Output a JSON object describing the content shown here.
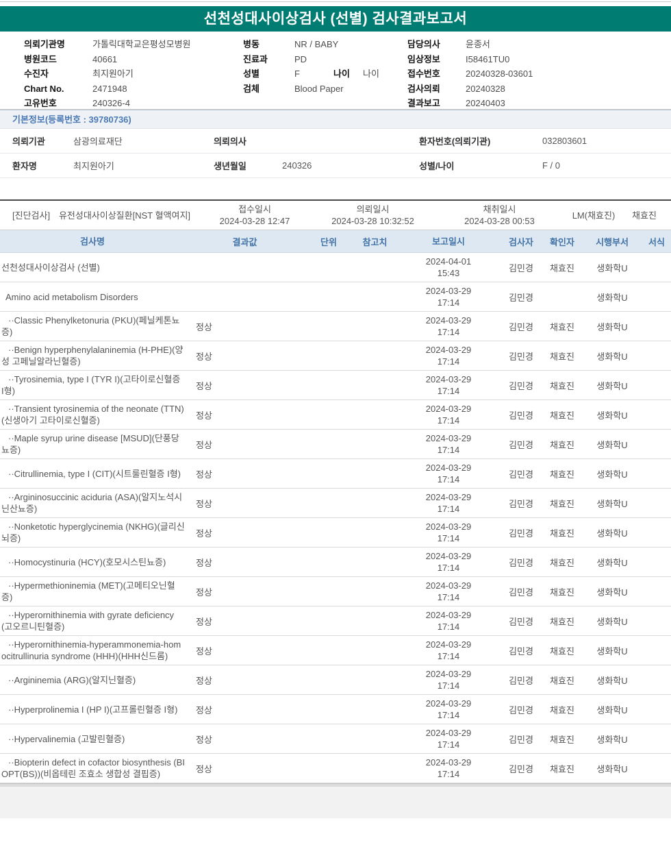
{
  "header": {
    "title": "선천성대사이상검사 (선별) 검사결과보고서",
    "accent_color": "#007c72"
  },
  "patient": {
    "col1": [
      {
        "label": "의뢰기관명",
        "value": "가톨릭대학교은평성모병원"
      },
      {
        "label": "병원코드",
        "value": "40661"
      },
      {
        "label": "수진자",
        "value": "최지원아기"
      },
      {
        "label": "Chart No.",
        "value": "2471948"
      },
      {
        "label": "고유번호",
        "value": "240326-4"
      }
    ],
    "col2": [
      {
        "label": "병동",
        "value": "NR / BABY"
      },
      {
        "label": "진료과",
        "value": "PD"
      },
      {
        "label": "성별",
        "value": "F",
        "label2": "나이",
        "value2": "나이"
      },
      {
        "label": "검체",
        "value": "Blood Paper"
      }
    ],
    "col3": [
      {
        "label": "담당의사",
        "value": "윤종서"
      },
      {
        "label": "임상정보",
        "value": "I58461TU0"
      },
      {
        "label": "접수번호",
        "value": "20240328-03601"
      },
      {
        "label": "검사의뢰",
        "value": "20240328"
      },
      {
        "label": "결과보고",
        "value": "20240403"
      }
    ]
  },
  "basic_info": {
    "title": "기본정보(등록번호 : 39780736)",
    "rows": [
      [
        {
          "label": "의뢰기관",
          "value": "삼광의료재단"
        },
        {
          "label": "의뢰의사",
          "value": ""
        },
        {
          "label": "환자번호(의뢰기관)",
          "value": "032803601"
        }
      ],
      [
        {
          "label": "환자명",
          "value": "최지원아기"
        },
        {
          "label": "생년월일",
          "value": "240326"
        },
        {
          "label": "성별/나이",
          "value": "F / 0"
        }
      ]
    ]
  },
  "diagnostic": {
    "section_label": "[진단검사]",
    "test_name": "유전성대사이상질환[NST 혈액여지]",
    "received_label": "접수일시",
    "received": "2024-03-28 12:47",
    "requested_label": "의뢰일시",
    "requested": "2024-03-28 10:32:52",
    "collected_label": "채취일시",
    "collected": "2024-03-28 00:53",
    "collector": "LM(채효진)",
    "phlebotomist": "채효진"
  },
  "results_table": {
    "headers": [
      "검사명",
      "결과값",
      "단위",
      "참고치",
      "보고일시",
      "검사자",
      "확인자",
      "시행부서",
      "서식"
    ],
    "rows": [
      {
        "level": 0,
        "name": "선천성대사이상검사 (선별)",
        "result": "",
        "unit": "",
        "ref": "",
        "reported": "2024-04-01 15:43",
        "tester": "김민경",
        "confirmer": "채효진",
        "dept": "생화학U",
        "format": ""
      },
      {
        "level": 1,
        "name": "Amino acid metabolism Disorders",
        "result": "",
        "unit": "",
        "ref": "",
        "reported": "2024-03-29 17:14",
        "tester": "김민경",
        "confirmer": "",
        "dept": "생화학U",
        "format": ""
      },
      {
        "level": 2,
        "name": "··Classic Phenylketonuria (PKU)(페닐케톤뇨증)",
        "result": "정상",
        "unit": "",
        "ref": "",
        "reported": "2024-03-29 17:14",
        "tester": "김민경",
        "confirmer": "채효진",
        "dept": "생화학U",
        "format": ""
      },
      {
        "level": 2,
        "name": "··Benign hyperphenylalaninemia (H-PHE)(양성 고페닐알라닌혈증)",
        "result": "정상",
        "unit": "",
        "ref": "",
        "reported": "2024-03-29 17:14",
        "tester": "김민경",
        "confirmer": "채효진",
        "dept": "생화학U",
        "format": ""
      },
      {
        "level": 2,
        "name": "··Tyrosinemia, type I (TYR I)(고타이로신혈증 I형)",
        "result": "정상",
        "unit": "",
        "ref": "",
        "reported": "2024-03-29 17:14",
        "tester": "김민경",
        "confirmer": "채효진",
        "dept": "생화학U",
        "format": ""
      },
      {
        "level": 2,
        "name": "··Transient tyrosinemia of the neonate (TTN)(신생아기 고타이로신혈증)",
        "result": "정상",
        "unit": "",
        "ref": "",
        "reported": "2024-03-29 17:14",
        "tester": "김민경",
        "confirmer": "채효진",
        "dept": "생화학U",
        "format": ""
      },
      {
        "level": 2,
        "name": "··Maple syrup urine disease [MSUD](단풍당뇨증)",
        "result": "정상",
        "unit": "",
        "ref": "",
        "reported": "2024-03-29 17:14",
        "tester": "김민경",
        "confirmer": "채효진",
        "dept": "생화학U",
        "format": ""
      },
      {
        "level": 2,
        "name": "··Citrullinemia, type I (CIT)(시트룰린혈증 I형)",
        "result": "정상",
        "unit": "",
        "ref": "",
        "reported": "2024-03-29 17:14",
        "tester": "김민경",
        "confirmer": "채효진",
        "dept": "생화학U",
        "format": ""
      },
      {
        "level": 2,
        "name": "··Argininosuccinic aciduria (ASA)(알지노석시닌산뇨증)",
        "result": "정상",
        "unit": "",
        "ref": "",
        "reported": "2024-03-29 17:14",
        "tester": "김민경",
        "confirmer": "채효진",
        "dept": "생화학U",
        "format": ""
      },
      {
        "level": 2,
        "name": "··Nonketotic hyperglycinemia (NKHG)(글리신뇌증)",
        "result": "정상",
        "unit": "",
        "ref": "",
        "reported": "2024-03-29 17:14",
        "tester": "김민경",
        "confirmer": "채효진",
        "dept": "생화학U",
        "format": ""
      },
      {
        "level": 2,
        "name": "··Homocystinuria (HCY)(호모시스틴뇨증)",
        "result": "정상",
        "unit": "",
        "ref": "",
        "reported": "2024-03-29 17:14",
        "tester": "김민경",
        "confirmer": "채효진",
        "dept": "생화학U",
        "format": ""
      },
      {
        "level": 2,
        "name": "··Hypermethioninemia (MET)(고메티오닌혈증)",
        "result": "정상",
        "unit": "",
        "ref": "",
        "reported": "2024-03-29 17:14",
        "tester": "김민경",
        "confirmer": "채효진",
        "dept": "생화학U",
        "format": ""
      },
      {
        "level": 2,
        "name": "··Hyperornithinemia with gyrate deficiency(고오르니틴혈증)",
        "result": "정상",
        "unit": "",
        "ref": "",
        "reported": "2024-03-29 17:14",
        "tester": "김민경",
        "confirmer": "채효진",
        "dept": "생화학U",
        "format": ""
      },
      {
        "level": 2,
        "name": "··Hyperornithinemia-hyperammonemia-homocitrullinuria syndrome (HHH)(HHH신드롬)",
        "result": "정상",
        "unit": "",
        "ref": "",
        "reported": "2024-03-29 17:14",
        "tester": "김민경",
        "confirmer": "채효진",
        "dept": "생화학U",
        "format": ""
      },
      {
        "level": 2,
        "name": "··Argininemia (ARG)(알지닌혈증)",
        "result": "정상",
        "unit": "",
        "ref": "",
        "reported": "2024-03-29 17:14",
        "tester": "김민경",
        "confirmer": "채효진",
        "dept": "생화학U",
        "format": ""
      },
      {
        "level": 2,
        "name": "··Hyperprolinemia I (HP I)(고프롤린혈증 I형)",
        "result": "정상",
        "unit": "",
        "ref": "",
        "reported": "2024-03-29 17:14",
        "tester": "김민경",
        "confirmer": "채효진",
        "dept": "생화학U",
        "format": ""
      },
      {
        "level": 2,
        "name": "··Hypervalinemia (고발린혈증)",
        "result": "정상",
        "unit": "",
        "ref": "",
        "reported": "2024-03-29 17:14",
        "tester": "김민경",
        "confirmer": "채효진",
        "dept": "생화학U",
        "format": ""
      },
      {
        "level": 2,
        "name": "··Biopterin defect in cofactor biosynthesis (BIOPT(BS))(비옵테린 조효소 생합성 결핍증)",
        "result": "정상",
        "unit": "",
        "ref": "",
        "reported": "2024-03-29 17:14",
        "tester": "김민경",
        "confirmer": "채효진",
        "dept": "생화학U",
        "format": ""
      }
    ]
  }
}
